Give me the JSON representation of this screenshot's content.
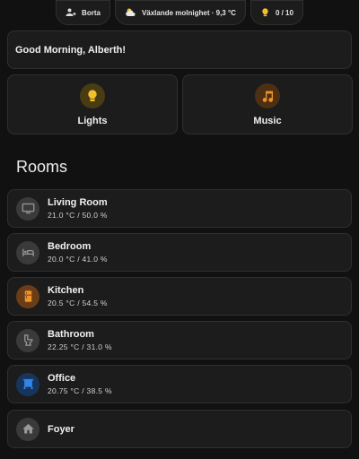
{
  "status": {
    "presence": "Borta",
    "weather": "Växlande molnighet · 9,3 °C",
    "lights_count": "0 / 10"
  },
  "greeting": "Good Morning, Alberth!",
  "tiles": [
    {
      "label": "Lights",
      "icon": "lightbulb-icon",
      "color": "#f2c12e"
    },
    {
      "label": "Music",
      "icon": "music-note-icon",
      "color": "#f0932b"
    }
  ],
  "rooms_title": "Rooms",
  "rooms": [
    {
      "name": "Living Room",
      "sub": "21.0 °C / 50.0 %",
      "icon": "tv-icon"
    },
    {
      "name": "Bedroom",
      "sub": "20.0 °C / 41.0 %",
      "icon": "bed-icon"
    },
    {
      "name": "Kitchen",
      "sub": "20.5 °C / 54.5 %",
      "icon": "fridge-icon",
      "color": "#f0932b"
    },
    {
      "name": "Bathroom",
      "sub": "22.25 °C / 31.0 %",
      "icon": "toilet-icon"
    },
    {
      "name": "Office",
      "sub": "20.75 °C / 38.5 %",
      "icon": "window-blind-icon",
      "color": "#2f86e8"
    },
    {
      "name": "Foyer",
      "sub": "",
      "icon": "home-icon"
    }
  ]
}
